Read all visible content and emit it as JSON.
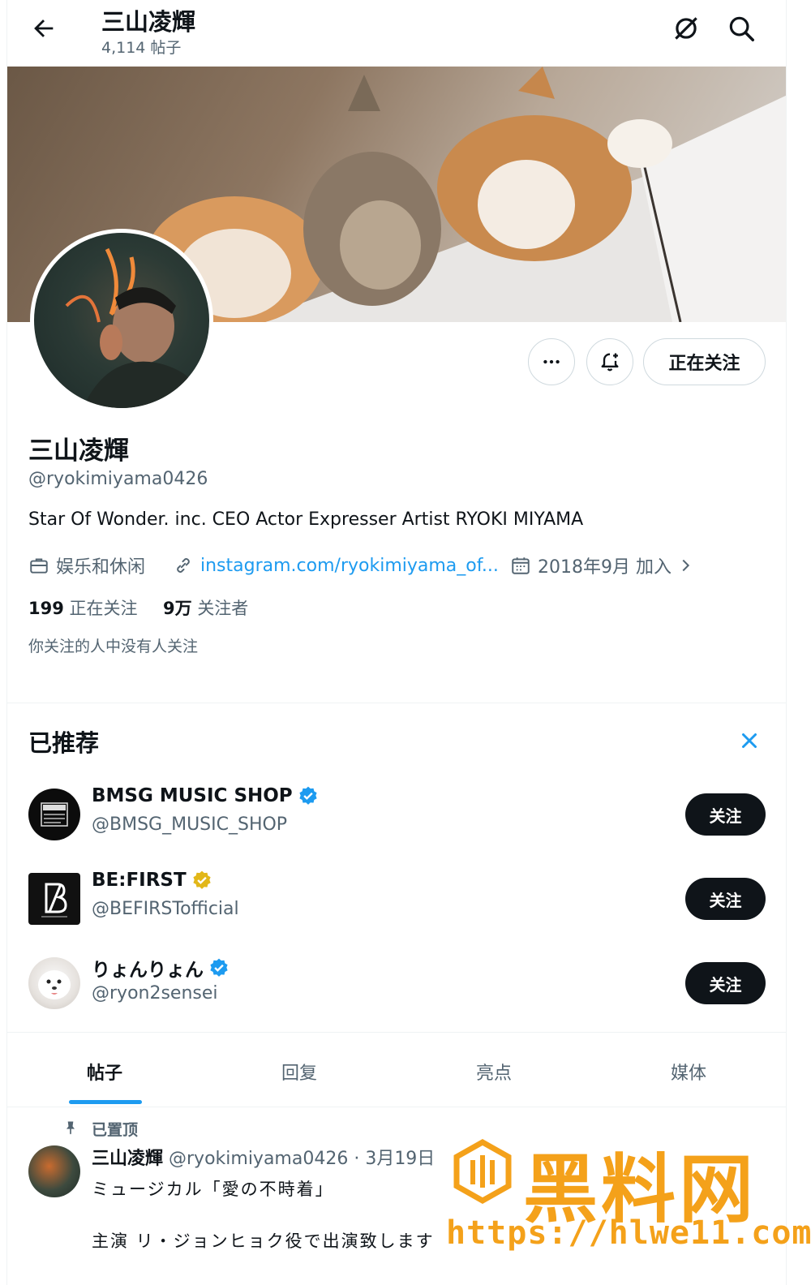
{
  "header": {
    "name": "三山凌輝",
    "post_count": "4,114 帖子"
  },
  "profile": {
    "display_name": "三山凌輝",
    "handle": "@ryokimiyama0426",
    "bio": "Star Of Wonder. inc. CEO Actor Expresser Artist RYOKI MIYAMA",
    "category": "娱乐和休闲",
    "link": "instagram.com/ryokimiyama_of...",
    "joined": "2018年9月 加入",
    "following_count": "199",
    "following_label": "正在关注",
    "followers_count": "9万",
    "followers_label": "关注者",
    "follow_note": "你关注的人中没有人关注",
    "following_button": "正在关注"
  },
  "recommended": {
    "title": "已推荐",
    "items": [
      {
        "name": "BMSG MUSIC SHOP",
        "handle": "@BMSG_MUSIC_SHOP",
        "badge_color": "#1d9bf0",
        "button": "关注"
      },
      {
        "name": "BE:FIRST",
        "handle": "@BEFIRSTofficial",
        "badge_color": "#e2b719",
        "button": "关注"
      },
      {
        "name": "りょんりょん",
        "handle": "@ryon2sensei",
        "badge_color": "#1d9bf0",
        "button": "关注"
      }
    ]
  },
  "tabs": [
    {
      "label": "帖子",
      "active": true
    },
    {
      "label": "回复",
      "active": false
    },
    {
      "label": "亮点",
      "active": false
    },
    {
      "label": "媒体",
      "active": false
    }
  ],
  "pinned_post": {
    "pinned_label": "已置顶",
    "author": "三山凌輝",
    "handle_date": "@ryokimiyama0426 · 3月19日",
    "line1": "ミュージカル「愛の不時着」",
    "line2": "主演 リ・ジョンヒョク役で出演致します"
  },
  "watermark": {
    "text": "黑料网",
    "url": "https://hlwe11.com"
  },
  "colors": {
    "accent": "#1d9bf0",
    "text": "#0f1419",
    "muted": "#536471",
    "watermark": "#f4a11a"
  }
}
